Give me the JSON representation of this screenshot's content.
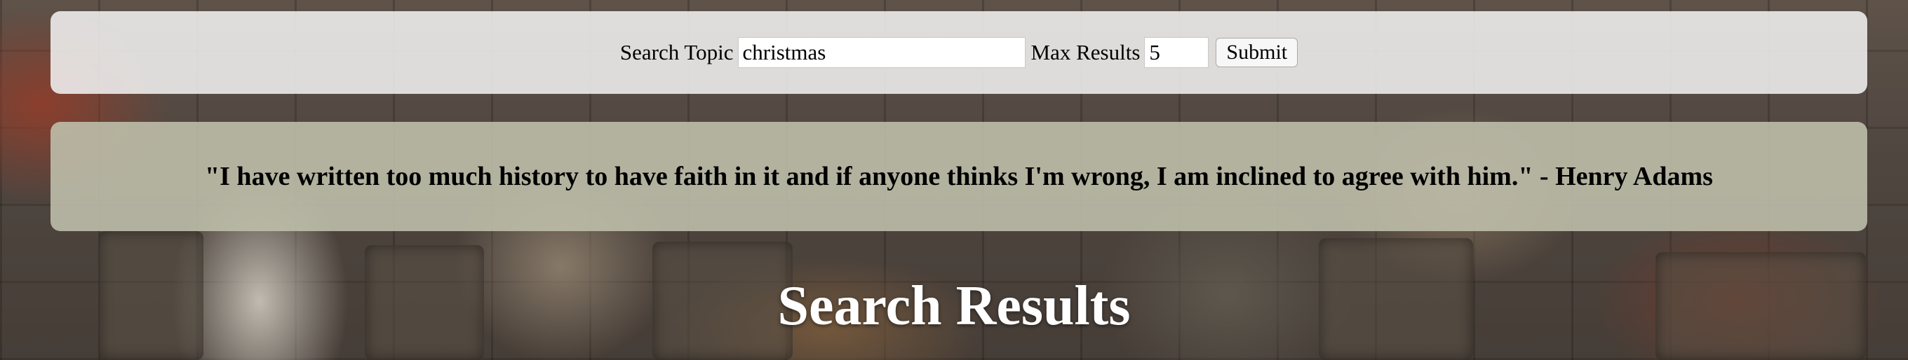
{
  "search": {
    "topic_label": "Search Topic",
    "topic_value": "christmas",
    "max_label": "Max Results",
    "max_value": "5",
    "submit_label": "Submit"
  },
  "quote": {
    "text": "\"I have written too much history to have faith in it and if anyone thinks I'm wrong, I am inclined to agree with him.\" - Henry Adams"
  },
  "results": {
    "heading": "Search Results"
  }
}
